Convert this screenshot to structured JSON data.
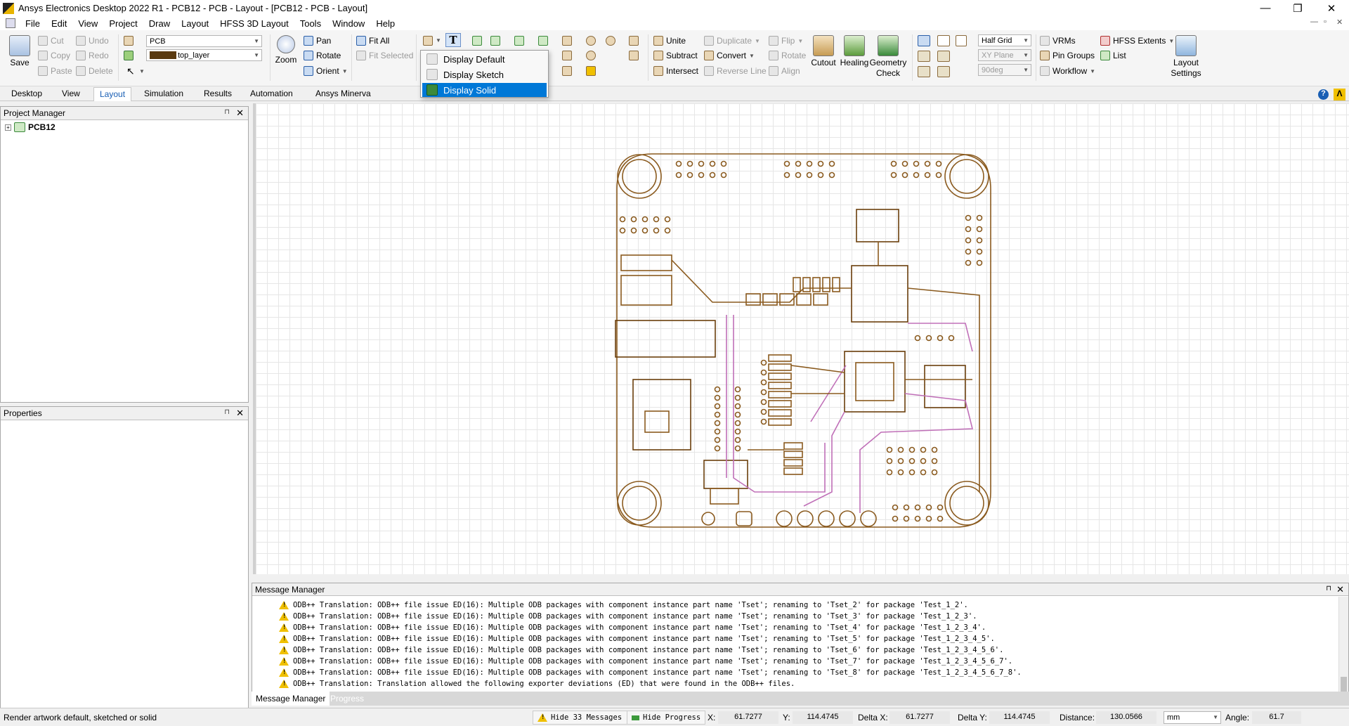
{
  "window": {
    "title": "Ansys Electronics Desktop 2022 R1 - PCB12 - PCB - Layout - [PCB12 - PCB - Layout]",
    "minimize": "—",
    "maximize": "❐",
    "close": "✕"
  },
  "menubar": {
    "items": [
      "File",
      "Edit",
      "View",
      "Project",
      "Draw",
      "Layout",
      "HFSS 3D Layout",
      "Tools",
      "Window",
      "Help"
    ],
    "doc_min": "—",
    "doc_restore": "▫",
    "doc_close": "✕"
  },
  "ribbon": {
    "save": "Save",
    "cut": "Cut",
    "copy": "Copy",
    "paste": "Paste",
    "undo": "Undo",
    "redo": "Redo",
    "delete": "Delete",
    "design_combo": "PCB",
    "layer_combo": "top_layer",
    "layer_color": "#5a3a10",
    "zoom": "Zoom",
    "pan": "Pan",
    "rotate": "Rotate",
    "orient": "Orient",
    "fit_all": "Fit All",
    "fit_selected": "Fit Selected",
    "unite": "Unite",
    "subtract": "Subtract",
    "intersect": "Intersect",
    "duplicate": "Duplicate",
    "convert": "Convert",
    "reverse_line": "Reverse Line",
    "flip": "Flip",
    "rotate2": "Rotate",
    "align": "Align",
    "cutout": "Cutout",
    "healing": "Healing",
    "geometry_check_1": "Geometry",
    "geometry_check_2": "Check",
    "grid_combo": "Half Grid",
    "plane_combo": "XY Plane",
    "angle_combo": "90deg",
    "vrms": "VRMs",
    "pin_groups": "Pin Groups",
    "workflow": "Workflow",
    "hfss_extents": "HFSS Extents",
    "list": "List",
    "layout_settings_1": "Layout",
    "layout_settings_2": "Settings"
  },
  "display_menu": {
    "items": [
      "Display Default",
      "Display Sketch",
      "Display Solid"
    ],
    "selected": "Display Solid"
  },
  "tabs": [
    "Desktop",
    "View",
    "Layout",
    "Simulation",
    "Results",
    "Automation",
    "Ansys Minerva"
  ],
  "active_tab": "Layout",
  "project_manager": {
    "title": "Project Manager",
    "tree_root": "PCB12",
    "expander": "+"
  },
  "properties": {
    "title": "Properties"
  },
  "message_manager": {
    "title": "Message Manager",
    "messages": [
      "ODB++ Translation: ODB++ file issue ED(16): Multiple ODB packages with component instance part name 'Tset'; renaming to 'Tset_2' for package 'Test_1_2'.",
      "ODB++ Translation: ODB++ file issue ED(16): Multiple ODB packages with component instance part name 'Tset'; renaming to 'Tset_3' for package 'Test_1_2_3'.",
      "ODB++ Translation: ODB++ file issue ED(16): Multiple ODB packages with component instance part name 'Tset'; renaming to 'Tset_4' for package 'Test_1_2_3_4'.",
      "ODB++ Translation: ODB++ file issue ED(16): Multiple ODB packages with component instance part name 'Tset'; renaming to 'Tset_5' for package 'Test_1_2_3_4_5'.",
      "ODB++ Translation: ODB++ file issue ED(16): Multiple ODB packages with component instance part name 'Tset'; renaming to 'Tset_6' for package 'Test_1_2_3_4_5_6'.",
      "ODB++ Translation: ODB++ file issue ED(16): Multiple ODB packages with component instance part name 'Tset'; renaming to 'Tset_7' for package 'Test_1_2_3_4_5_6_7'.",
      "ODB++ Translation: ODB++ file issue ED(16): Multiple ODB packages with component instance part name 'Tset'; renaming to 'Tset_8' for package 'Test_1_2_3_4_5_6_7_8'.",
      "ODB++ Translation: Translation allowed the following exporter deviations (ED) that were found in the ODB++ files."
    ],
    "tab_messages": "Message Manager",
    "tab_progress": "Progress"
  },
  "status": {
    "hint": "Render artwork default, sketched or solid",
    "hide_messages": "Hide 33 Messages",
    "hide_progress": "Hide Progress",
    "x_label": "X:",
    "x_value": "61.7277",
    "y_label": "Y:",
    "y_value": "114.4745",
    "dx_label": "Delta X:",
    "dx_value": "61.7277",
    "dy_label": "Delta Y:",
    "dy_value": "114.4745",
    "dist_label": "Distance:",
    "dist_value": "130.0566",
    "unit": "mm",
    "angle_label": "Angle:",
    "angle_value": "61.7"
  },
  "colors": {
    "trace": "#8a5a1e",
    "trace_dark": "#6b3f0c",
    "inner_trace": "#c070b8",
    "accent": "#0078d7"
  }
}
